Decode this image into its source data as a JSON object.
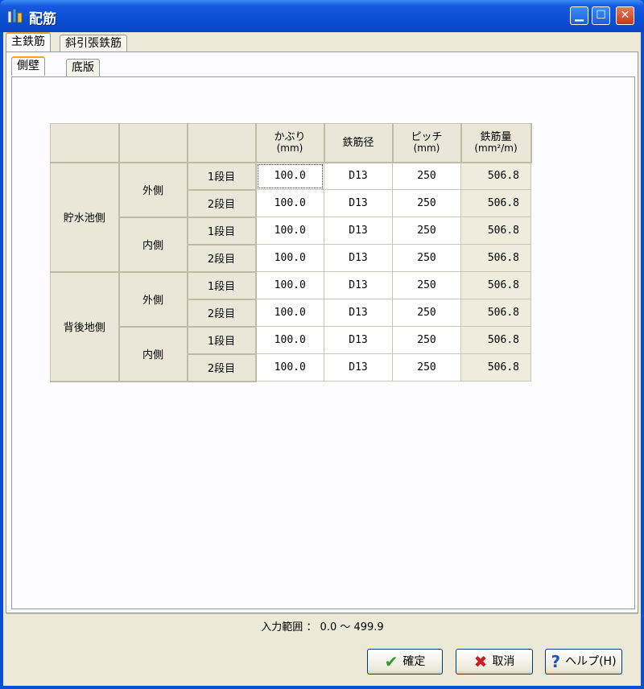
{
  "window": {
    "title": "配筋"
  },
  "tabs_main": [
    "主鉄筋",
    "斜引張鉄筋"
  ],
  "tabs_sub": [
    "側壁",
    "底版"
  ],
  "table": {
    "headers": {
      "cover": {
        "label": "かぶり",
        "unit": "(mm)"
      },
      "diameter": {
        "label": "鉄筋径"
      },
      "pitch": {
        "label": "ピッチ",
        "unit": "(mm)"
      },
      "amount": {
        "label": "鉄筋量",
        "unit": "(mm²/m)"
      }
    },
    "groups": [
      {
        "label": "貯水池側",
        "sides": [
          {
            "label": "外側",
            "rows": [
              {
                "level": "1段目",
                "cover": "100.0",
                "dia": "D13",
                "pitch": "250",
                "amount": "506.8"
              },
              {
                "level": "2段目",
                "cover": "100.0",
                "dia": "D13",
                "pitch": "250",
                "amount": "506.8"
              }
            ]
          },
          {
            "label": "内側",
            "rows": [
              {
                "level": "1段目",
                "cover": "100.0",
                "dia": "D13",
                "pitch": "250",
                "amount": "506.8"
              },
              {
                "level": "2段目",
                "cover": "100.0",
                "dia": "D13",
                "pitch": "250",
                "amount": "506.8"
              }
            ]
          }
        ]
      },
      {
        "label": "背後地側",
        "sides": [
          {
            "label": "外側",
            "rows": [
              {
                "level": "1段目",
                "cover": "100.0",
                "dia": "D13",
                "pitch": "250",
                "amount": "506.8"
              },
              {
                "level": "2段目",
                "cover": "100.0",
                "dia": "D13",
                "pitch": "250",
                "amount": "506.8"
              }
            ]
          },
          {
            "label": "内側",
            "rows": [
              {
                "level": "1段目",
                "cover": "100.0",
                "dia": "D13",
                "pitch": "250",
                "amount": "506.8"
              },
              {
                "level": "2段目",
                "cover": "100.0",
                "dia": "D13",
                "pitch": "250",
                "amount": "506.8"
              }
            ]
          }
        ]
      }
    ]
  },
  "status": {
    "text": "入力範囲 ： 0.0 ～ 499.9"
  },
  "buttons": {
    "ok": {
      "label": "確定",
      "icon": "check-icon",
      "color": "#2f9a2f"
    },
    "cancel": {
      "label": "取消",
      "icon": "x-icon",
      "color": "#c82020"
    },
    "help": {
      "label": "ヘルプ(H)",
      "icon": "question-icon",
      "color": "#1a56c0"
    }
  }
}
